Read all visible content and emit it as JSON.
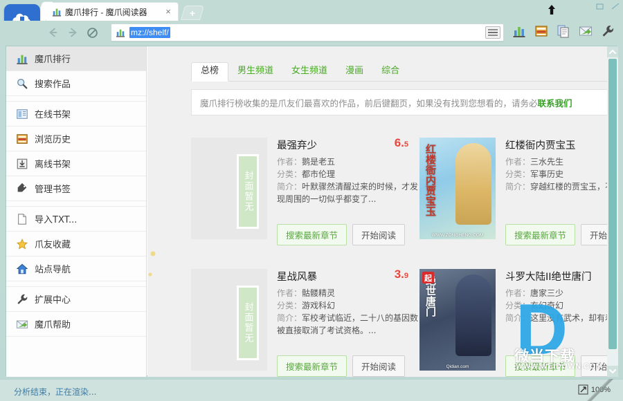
{
  "window": {
    "tab": {
      "title": "魔爪排行 - 魔爪阅读器",
      "favicon": "chart-bars-icon",
      "close_label": "×"
    },
    "new_tab_label": "+",
    "logo_name": "app-logo-cloud-book"
  },
  "nav": {
    "back_label": "←",
    "forward_label": "→",
    "stop_label": "⊘",
    "url": "mz://shelf/",
    "url_favicon": "chart-bars-icon",
    "dropdown_name": "address-history-dropdown",
    "tools": [
      {
        "name": "ranking-icon",
        "label": "魔爪排行"
      },
      {
        "name": "bookshelf-icon",
        "label": "在线书架"
      },
      {
        "name": "documents-icon",
        "label": "导入TXT"
      },
      {
        "name": "mail-help-icon",
        "label": "魔爪帮助"
      },
      {
        "name": "wrench-settings-icon",
        "label": "扩展中心"
      }
    ]
  },
  "sidebar": {
    "items": [
      {
        "label": "魔爪排行",
        "icon": "chart-bars-icon",
        "active": true,
        "gap_after": false
      },
      {
        "label": "搜索作品",
        "icon": "magnifier-icon",
        "active": false,
        "gap_after": true
      },
      {
        "label": "在线书架",
        "icon": "open-book-icon",
        "active": false,
        "gap_after": false
      },
      {
        "label": "浏览历史",
        "icon": "history-grid-icon",
        "active": false,
        "gap_after": false
      },
      {
        "label": "离线书架",
        "icon": "download-box-icon",
        "active": false,
        "gap_after": false
      },
      {
        "label": "管理书签",
        "icon": "tag-bookmark-icon",
        "active": false,
        "gap_after": true
      },
      {
        "label": "导入TXT...",
        "icon": "file-page-icon",
        "active": false,
        "gap_after": false
      },
      {
        "label": "爪友收藏",
        "icon": "star-icon",
        "active": false,
        "gap_after": false
      },
      {
        "label": "站点导航",
        "icon": "home-icon",
        "active": false,
        "gap_after": true
      },
      {
        "label": "扩展中心",
        "icon": "wrench-icon",
        "active": false,
        "gap_after": false
      },
      {
        "label": "魔爪帮助",
        "icon": "mail-help-icon",
        "active": false,
        "gap_after": false
      }
    ]
  },
  "content": {
    "tabs": [
      {
        "label": "总榜",
        "active": true
      },
      {
        "label": "男生频道",
        "active": false
      },
      {
        "label": "女生频道",
        "active": false
      },
      {
        "label": "漫画",
        "active": false
      },
      {
        "label": "综合",
        "active": false
      }
    ],
    "notice": {
      "text": "魔爪排行榜收集的是爪友们最喜欢的作品，前后键翻页，如果没有找到您想看的，请务必",
      "link": "联系我们"
    },
    "labels": {
      "author": "作者：",
      "category": "分类：",
      "summary": "简介：",
      "search_chapter": "搜索最新章节",
      "start_reading": "开始阅读",
      "cover_placeholder": "封面暂无"
    },
    "books": [
      {
        "title": "最强弃少",
        "score": "6.5",
        "author": "鹅是老五",
        "category": "都市伦理",
        "summary": "叶默骤然清醒过来的时候，才发现周围的一切似乎都变了...",
        "cover_type": "placeholder"
      },
      {
        "title": "红楼衙内贾宝玉",
        "score": "",
        "author": "三水先生",
        "category": "军事历史",
        "summary": "穿越红楼的贾宝玉，不...",
        "cover_type": "image",
        "cover_text": "红楼衙内贾宝玉",
        "cover_site": "WWW.ZONGHENG.COM"
      },
      {
        "title": "星战风暴",
        "score": "3.9",
        "author": "骷髅精灵",
        "category": "游戏科幻",
        "summary": "军校考试临近，二十八的基因数被直接取消了考试资格。...",
        "cover_type": "placeholder"
      },
      {
        "title": "斗罗大陆II绝世唐门",
        "score": "",
        "author": "唐家三少",
        "category": "玄幻奇幻",
        "summary": "这里没有武术，却有着...",
        "cover_type": "image",
        "cover_text": "绝世唐门",
        "cover_site": "Qidian.com"
      }
    ]
  },
  "watermark": {
    "letter": "D",
    "name": "微当下载",
    "url": "WWW.WEIDOWN.COM"
  },
  "statusbar": {
    "message": "分析结束，正在渲染...",
    "zoom": "100%"
  }
}
